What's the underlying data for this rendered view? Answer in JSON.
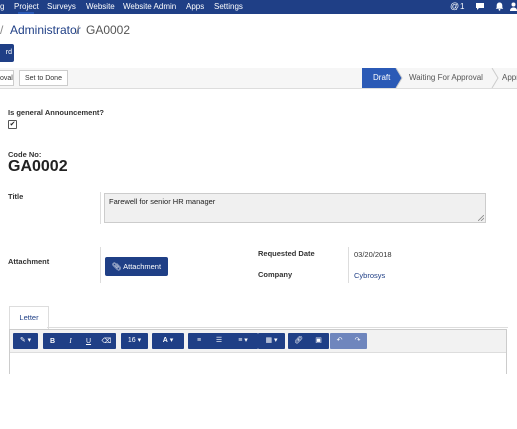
{
  "topbar": {
    "menu": [
      "g",
      "Project",
      "Surveys",
      "Website",
      "Website Admin",
      "Apps",
      "Settings"
    ],
    "notif_count": "1"
  },
  "breadcrumb": {
    "sep1": "/",
    "parent": "Administrator",
    "sep2": "/",
    "current": "GA0002"
  },
  "control": {
    "create_label": "rd"
  },
  "statusbar": {
    "btn_approval": "oval",
    "btn_done": "Set to Done",
    "stages": [
      "Draft",
      "Waiting For Approval",
      "Appr"
    ]
  },
  "form": {
    "general_label": "Is general Announcement?",
    "general_checked": "✔",
    "code_label": "Code No:",
    "code_value": "GA0002",
    "title_label": "Title",
    "title_value": "Farewell for senior HR manager",
    "attachment_label": "Attachment",
    "attachment_button": "Attachment",
    "requested_date_label": "Requested Date",
    "requested_date_value": "03/20/2018",
    "company_label": "Company",
    "company_value": "Cybrosys"
  },
  "tabs": {
    "letter": "Letter"
  },
  "toolbar": {
    "font_size": "16",
    "font_color_label": "A"
  },
  "colors": {
    "brand": "#1f3f86",
    "active_stage": "#2b5ab6"
  }
}
